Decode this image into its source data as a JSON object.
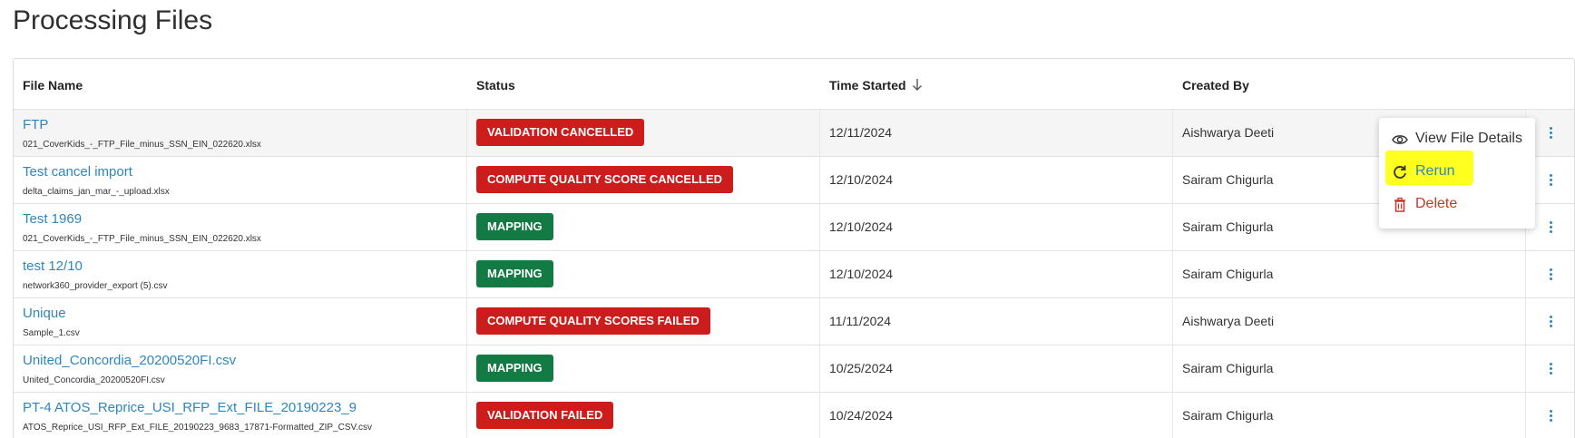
{
  "page": {
    "title": "Processing Files"
  },
  "table": {
    "headers": {
      "file_name": "File Name",
      "status": "Status",
      "time_started": "Time Started",
      "created_by": "Created By"
    },
    "sort_icon": "arrow-down-icon",
    "rows": [
      {
        "title": "FTP",
        "file": "021_CoverKids_-_FTP_File_minus_SSN_EIN_022620.xlsx",
        "status": "VALIDATION CANCELLED",
        "status_color": "#cc1c1c",
        "time": "12/11/2024",
        "created_by": "Aishwarya Deeti"
      },
      {
        "title": "Test cancel import",
        "file": "delta_claims_jan_mar_-_upload.xlsx",
        "status": "COMPUTE QUALITY SCORE CANCELLED",
        "status_color": "#cc1c1c",
        "time": "12/10/2024",
        "created_by": "Sairam Chigurla"
      },
      {
        "title": "Test 1969",
        "file": "021_CoverKids_-_FTP_File_minus_SSN_EIN_022620.xlsx",
        "status": "MAPPING",
        "status_color": "#137a43",
        "time": "12/10/2024",
        "created_by": "Sairam Chigurla"
      },
      {
        "title": "test 12/10",
        "file": "network360_provider_export (5).csv",
        "status": "MAPPING",
        "status_color": "#137a43",
        "time": "12/10/2024",
        "created_by": "Sairam Chigurla"
      },
      {
        "title": "Unique",
        "file": "Sample_1.csv",
        "status": "COMPUTE QUALITY SCORES FAILED",
        "status_color": "#cc1c1c",
        "time": "11/11/2024",
        "created_by": "Aishwarya Deeti"
      },
      {
        "title": "United_Concordia_20200520FI.csv",
        "file": "United_Concordia_20200520FI.csv",
        "status": "MAPPING",
        "status_color": "#137a43",
        "time": "10/25/2024",
        "created_by": "Sairam Chigurla"
      },
      {
        "title": "PT-4 ATOS_Reprice_USI_RFP_Ext_FILE_20190223_9",
        "file": "ATOS_Reprice_USI_RFP_Ext_FILE_20190223_9683_17871-Formatted_ZIP_CSV.csv",
        "status": "VALIDATION FAILED",
        "status_color": "#cc1c1c",
        "time": "10/24/2024",
        "created_by": "Sairam Chigurla"
      }
    ]
  },
  "context_menu": {
    "items": [
      {
        "label": "View File Details",
        "icon": "eye-icon"
      },
      {
        "label": "Rerun",
        "icon": "refresh-icon",
        "highlight_color": "#ffff20"
      },
      {
        "label": "Delete",
        "icon": "trash-icon"
      }
    ]
  },
  "colors": {
    "link": "#2e86c1",
    "danger": "#cc1c1c",
    "success": "#137a43",
    "delete": "#c0392b"
  }
}
